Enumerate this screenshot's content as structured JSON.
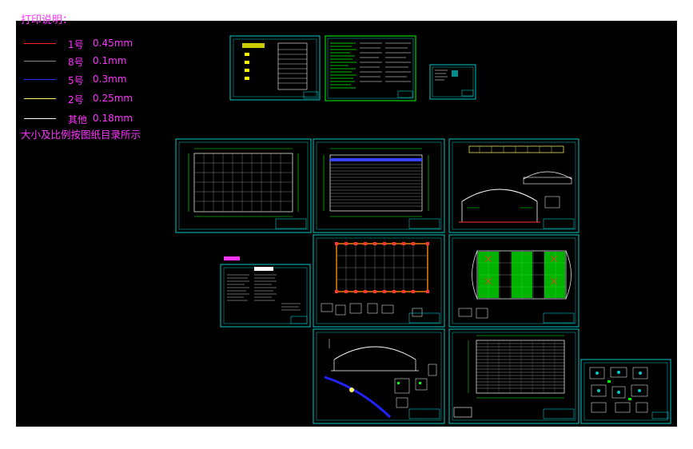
{
  "legend": {
    "title": "打印说明：",
    "items": [
      {
        "label": "1号",
        "width": "0.45mm",
        "color": "#ff2222"
      },
      {
        "label": "8号",
        "width": "0.1mm",
        "color": "#888888"
      },
      {
        "label": "5号",
        "width": "0.3mm",
        "color": "#2233ff"
      },
      {
        "label": "2号",
        "width": "0.25mm",
        "color": "#ffff66"
      },
      {
        "label": "其他",
        "width": "0.18mm",
        "color": "#ffffff"
      }
    ],
    "note": "大小及比例按图纸目录所示"
  },
  "sheets": [
    {
      "name": "cover-sheet",
      "title": "图纸目录"
    },
    {
      "name": "design-notes-sheet",
      "title": "设计说明"
    },
    {
      "name": "small-detail-sheet",
      "title": ""
    },
    {
      "name": "column-layout-plan",
      "title": ""
    },
    {
      "name": "roof-plan",
      "title": ""
    },
    {
      "name": "elevation-section",
      "title": ""
    },
    {
      "name": "foundation-notes-sheet",
      "title": ""
    },
    {
      "name": "foundation-plan",
      "title": ""
    },
    {
      "name": "anchor-plan",
      "title": ""
    },
    {
      "name": "arch-section-sheet",
      "title": ""
    },
    {
      "name": "roof-panel-plan",
      "title": ""
    },
    {
      "name": "node-details-sheet",
      "title": ""
    }
  ]
}
